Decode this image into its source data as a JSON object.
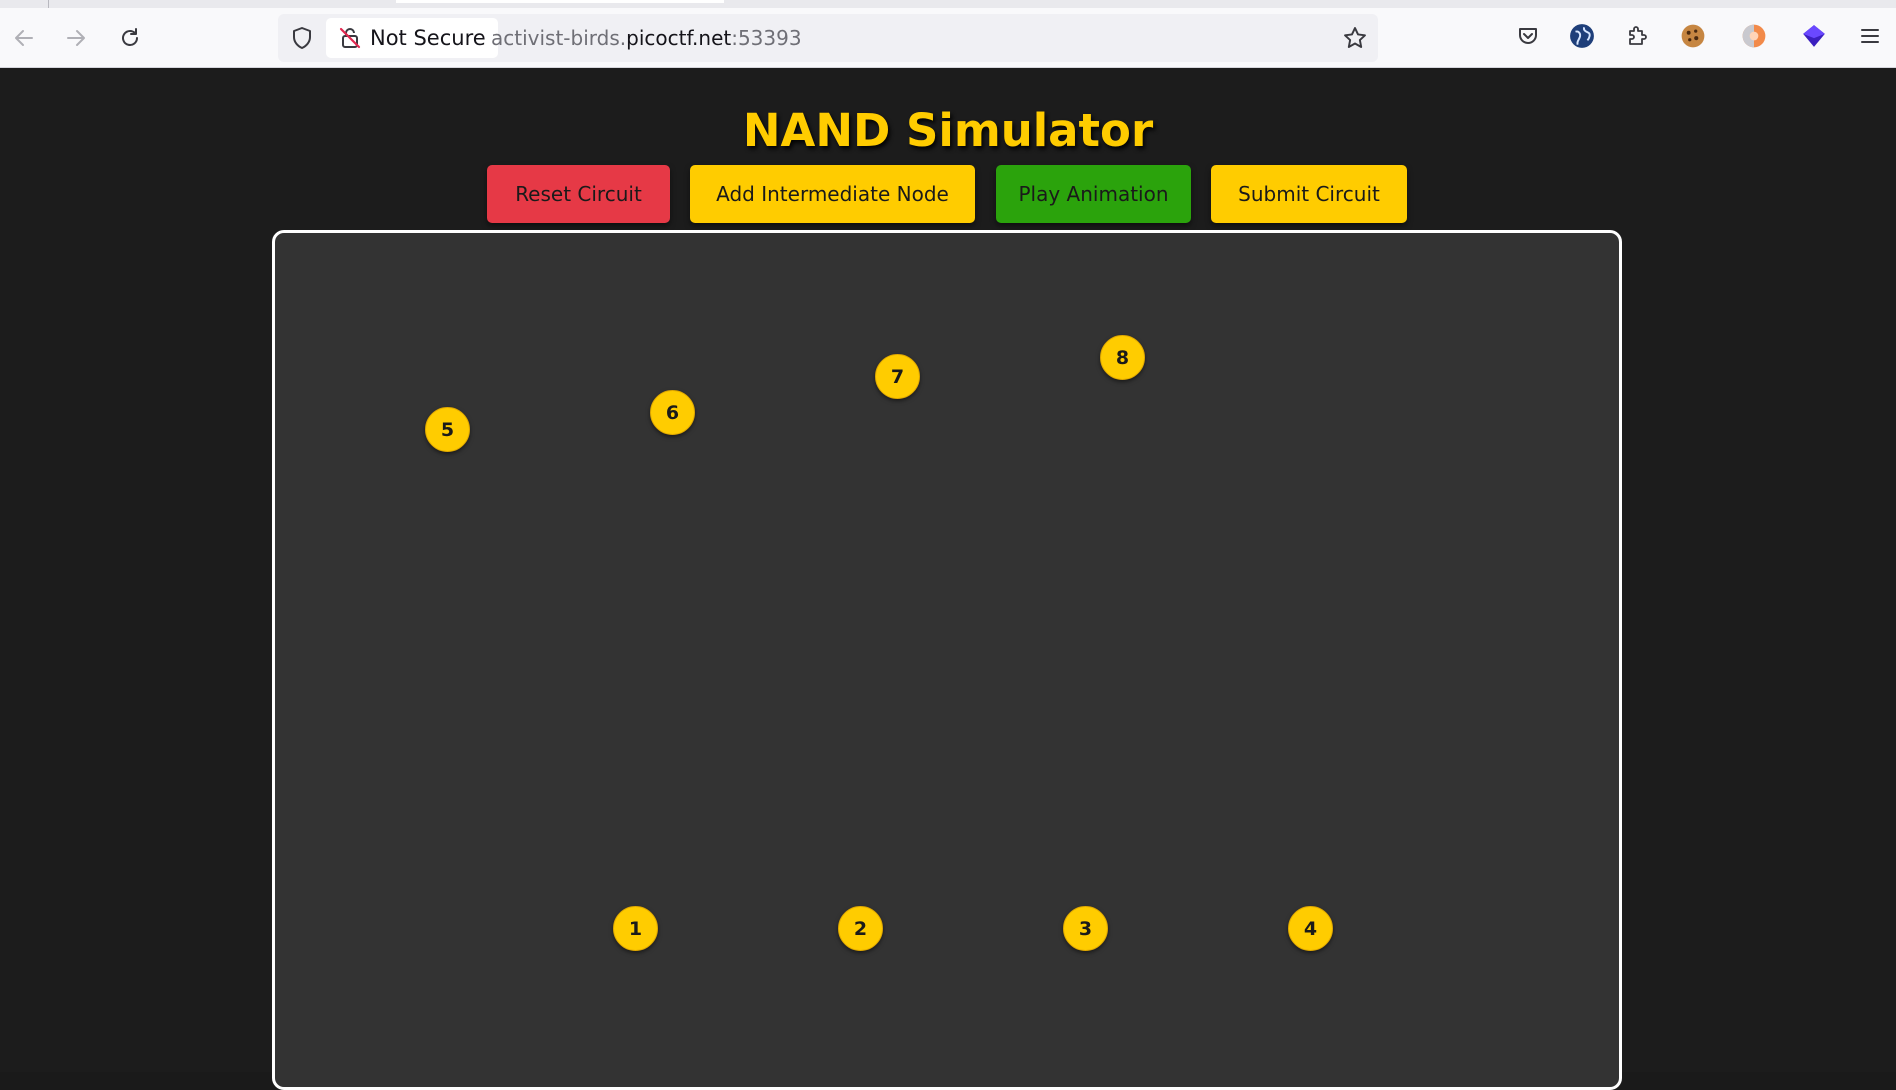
{
  "browser": {
    "security_label": "Not Secure",
    "url_prefix": "activist-birds.",
    "url_host": "picoctf.net",
    "url_port": ":53393",
    "icons": [
      "back-arrow-icon",
      "forward-arrow-icon",
      "reload-icon",
      "shield-icon",
      "insecure-lock-icon",
      "bookmark-star-icon",
      "pocket-icon",
      "globe-extension-icon",
      "extensions-puzzle-icon",
      "cookie-extension-icon",
      "orange-circle-extension-icon",
      "purple-cube-extension-icon",
      "hamburger-menu-icon"
    ]
  },
  "page": {
    "title": "NAND Simulator",
    "colors": {
      "accent": "#ffcc00",
      "reset": "#e63946",
      "play": "#2ba30c",
      "canvas": "#333333",
      "background": "#1c1c1c"
    }
  },
  "controls": {
    "reset_label": "Reset Circuit",
    "add_node_label": "Add Intermediate Node",
    "play_label": "Play Animation",
    "submit_label": "Submit Circuit"
  },
  "nodes": {
    "n1": "1",
    "n2": "2",
    "n3": "3",
    "n4": "4",
    "n5": "5",
    "n6": "6",
    "n7": "7",
    "n8": "8"
  }
}
